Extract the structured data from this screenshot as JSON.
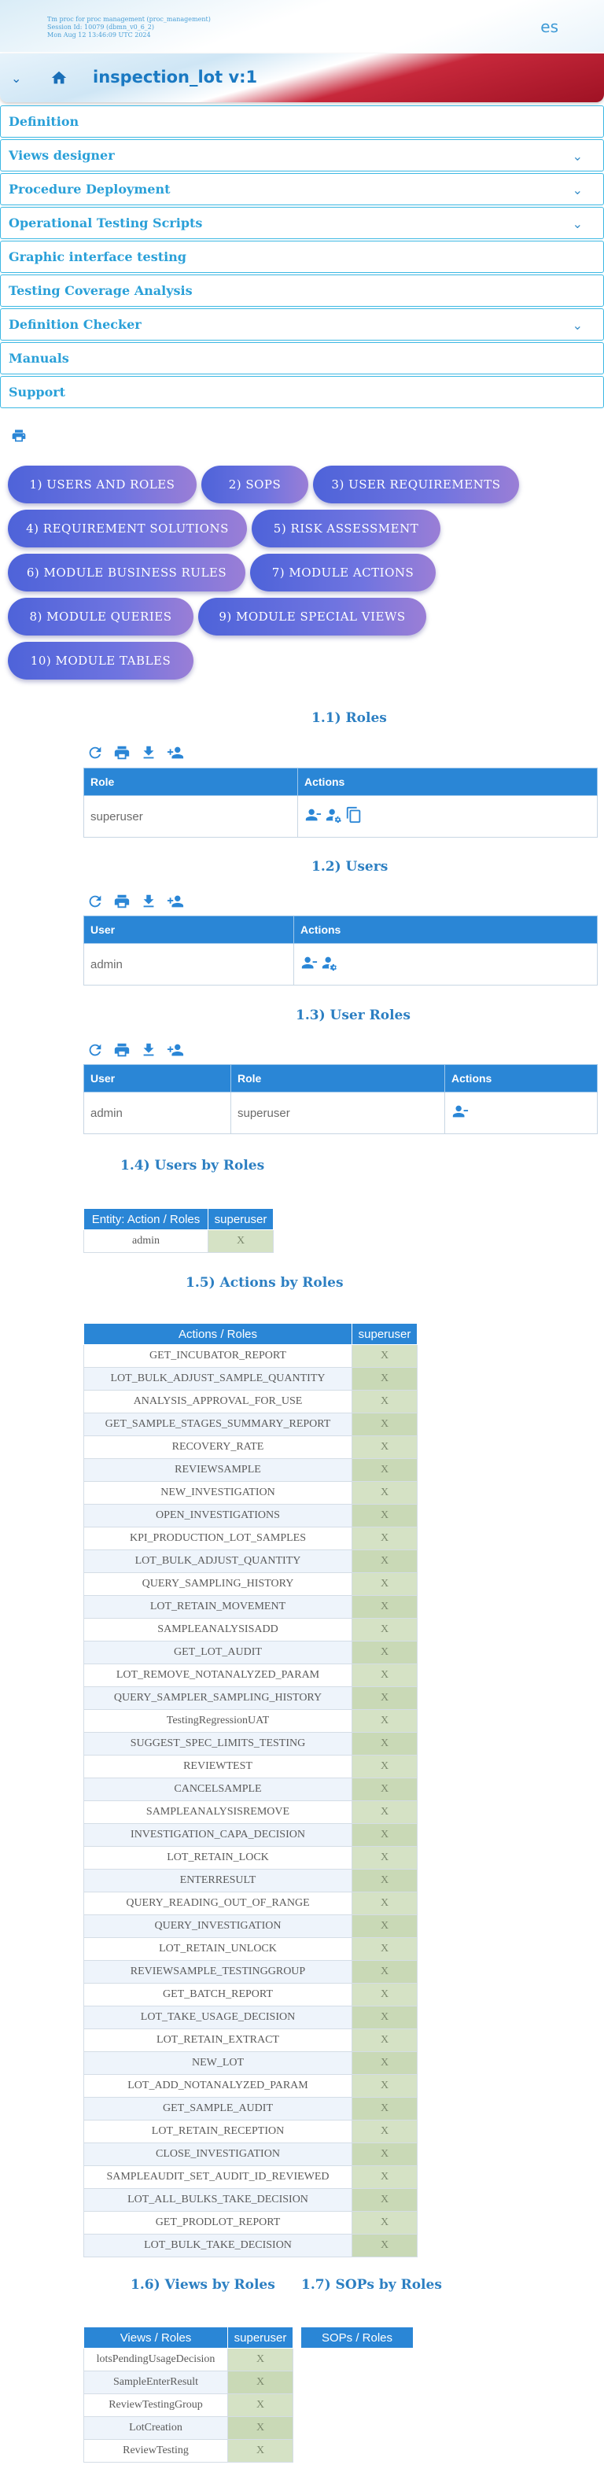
{
  "session": {
    "line1": "Tm proc for proc management (proc_management)",
    "line2": "Session Id: 10079 (dbmn_v0_6_2)",
    "line3": "Mon Aug 12 13:46:09 UTC 2024",
    "language": "es"
  },
  "header": {
    "title": "inspection_lot v:1"
  },
  "menu": [
    {
      "label": "Definition",
      "has_caret": false
    },
    {
      "label": "Views designer",
      "has_caret": true
    },
    {
      "label": "Procedure Deployment",
      "has_caret": true
    },
    {
      "label": "Operational Testing Scripts",
      "has_caret": true
    },
    {
      "label": "Graphic interface testing",
      "has_caret": false
    },
    {
      "label": "Testing Coverage Analysis",
      "has_caret": false
    },
    {
      "label": "Definition Checker",
      "has_caret": true
    },
    {
      "label": "Manuals",
      "has_caret": false
    },
    {
      "label": "Support",
      "has_caret": false
    }
  ],
  "nav_buttons": [
    "1) USERS AND ROLES",
    "2) SOPS",
    "3) USER REQUIREMENTS",
    "4) REQUIREMENT SOLUTIONS",
    "5) RISK ASSESSMENT",
    "6) MODULE BUSINESS RULES",
    "7) MODULE ACTIONS",
    "8) MODULE QUERIES",
    "9) MODULE SPECIAL VIEWS",
    "10) MODULE TABLES"
  ],
  "sections": {
    "roles": {
      "title": "1.1) Roles",
      "col_role": "Role",
      "col_actions": "Actions",
      "rows": [
        "superuser"
      ]
    },
    "users": {
      "title": "1.2) Users",
      "col_user": "User",
      "col_actions": "Actions",
      "rows": [
        "admin"
      ]
    },
    "user_roles": {
      "title": "1.3) User Roles",
      "col_user": "User",
      "col_role": "Role",
      "col_actions": "Actions",
      "rows": [
        {
          "user": "admin",
          "role": "superuser"
        }
      ]
    },
    "users_by_roles": {
      "title": "1.4) Users by Roles",
      "header": "Entity: Action / Roles",
      "role": "superuser",
      "rows": [
        {
          "name": "admin",
          "mark": "X"
        }
      ]
    },
    "actions_by_roles": {
      "title": "1.5) Actions by Roles",
      "header": "Actions / Roles",
      "role": "superuser",
      "rows": [
        {
          "name": "GET_INCUBATOR_REPORT",
          "mark": "X"
        },
        {
          "name": "LOT_BULK_ADJUST_SAMPLE_QUANTITY",
          "mark": "X"
        },
        {
          "name": "ANALYSIS_APPROVAL_FOR_USE",
          "mark": "X"
        },
        {
          "name": "GET_SAMPLE_STAGES_SUMMARY_REPORT",
          "mark": "X"
        },
        {
          "name": "RECOVERY_RATE",
          "mark": "X"
        },
        {
          "name": "REVIEWSAMPLE",
          "mark": "X"
        },
        {
          "name": "NEW_INVESTIGATION",
          "mark": "X"
        },
        {
          "name": "OPEN_INVESTIGATIONS",
          "mark": "X"
        },
        {
          "name": "KPI_PRODUCTION_LOT_SAMPLES",
          "mark": "X"
        },
        {
          "name": "LOT_BULK_ADJUST_QUANTITY",
          "mark": "X"
        },
        {
          "name": "QUERY_SAMPLING_HISTORY",
          "mark": "X"
        },
        {
          "name": "LOT_RETAIN_MOVEMENT",
          "mark": "X"
        },
        {
          "name": "SAMPLEANALYSISADD",
          "mark": "X"
        },
        {
          "name": "GET_LOT_AUDIT",
          "mark": "X"
        },
        {
          "name": "LOT_REMOVE_NOTANALYZED_PARAM",
          "mark": "X"
        },
        {
          "name": "QUERY_SAMPLER_SAMPLING_HISTORY",
          "mark": "X"
        },
        {
          "name": "TestingRegressionUAT",
          "mark": "X"
        },
        {
          "name": "SUGGEST_SPEC_LIMITS_TESTING",
          "mark": "X"
        },
        {
          "name": "REVIEWTEST",
          "mark": "X"
        },
        {
          "name": "CANCELSAMPLE",
          "mark": "X"
        },
        {
          "name": "SAMPLEANALYSISREMOVE",
          "mark": "X"
        },
        {
          "name": "INVESTIGATION_CAPA_DECISION",
          "mark": "X"
        },
        {
          "name": "LOT_RETAIN_LOCK",
          "mark": "X"
        },
        {
          "name": "ENTERRESULT",
          "mark": "X"
        },
        {
          "name": "QUERY_READING_OUT_OF_RANGE",
          "mark": "X"
        },
        {
          "name": "QUERY_INVESTIGATION",
          "mark": "X"
        },
        {
          "name": "LOT_RETAIN_UNLOCK",
          "mark": "X"
        },
        {
          "name": "REVIEWSAMPLE_TESTINGGROUP",
          "mark": "X"
        },
        {
          "name": "GET_BATCH_REPORT",
          "mark": "X"
        },
        {
          "name": "LOT_TAKE_USAGE_DECISION",
          "mark": "X"
        },
        {
          "name": "LOT_RETAIN_EXTRACT",
          "mark": "X"
        },
        {
          "name": "NEW_LOT",
          "mark": "X"
        },
        {
          "name": "LOT_ADD_NOTANALYZED_PARAM",
          "mark": "X"
        },
        {
          "name": "GET_SAMPLE_AUDIT",
          "mark": "X"
        },
        {
          "name": "LOT_RETAIN_RECEPTION",
          "mark": "X"
        },
        {
          "name": "CLOSE_INVESTIGATION",
          "mark": "X"
        },
        {
          "name": "SAMPLEAUDIT_SET_AUDIT_ID_REVIEWED",
          "mark": "X"
        },
        {
          "name": "LOT_ALL_BULKS_TAKE_DECISION",
          "mark": "X"
        },
        {
          "name": "GET_PRODLOT_REPORT",
          "mark": "X"
        },
        {
          "name": "LOT_BULK_TAKE_DECISION",
          "mark": "X"
        }
      ]
    },
    "views_by_roles": {
      "title": "1.6) Views by Roles",
      "header": "Views / Roles",
      "role": "superuser",
      "rows": [
        {
          "name": "lotsPendingUsageDecision",
          "mark": "X"
        },
        {
          "name": "SampleEnterResult",
          "mark": "X"
        },
        {
          "name": "ReviewTestingGroup",
          "mark": "X"
        },
        {
          "name": "LotCreation",
          "mark": "X"
        },
        {
          "name": "ReviewTesting",
          "mark": "X"
        }
      ]
    },
    "sops_by_roles": {
      "title": "1.7) SOPs by Roles",
      "header": "SOPs / Roles"
    }
  },
  "colors": {
    "accent": "#2a86d6",
    "pill_start": "#4e63d9",
    "pill_end": "#9a7ed6",
    "brand_red": "#b0182d",
    "check_cell": "#d5e2c5"
  },
  "icons": [
    "refresh-icon",
    "print-icon",
    "download-icon",
    "add-person-icon",
    "remove-person-icon",
    "manage-roles-icon",
    "copy-icon",
    "home-icon",
    "chevron-down-icon"
  ]
}
